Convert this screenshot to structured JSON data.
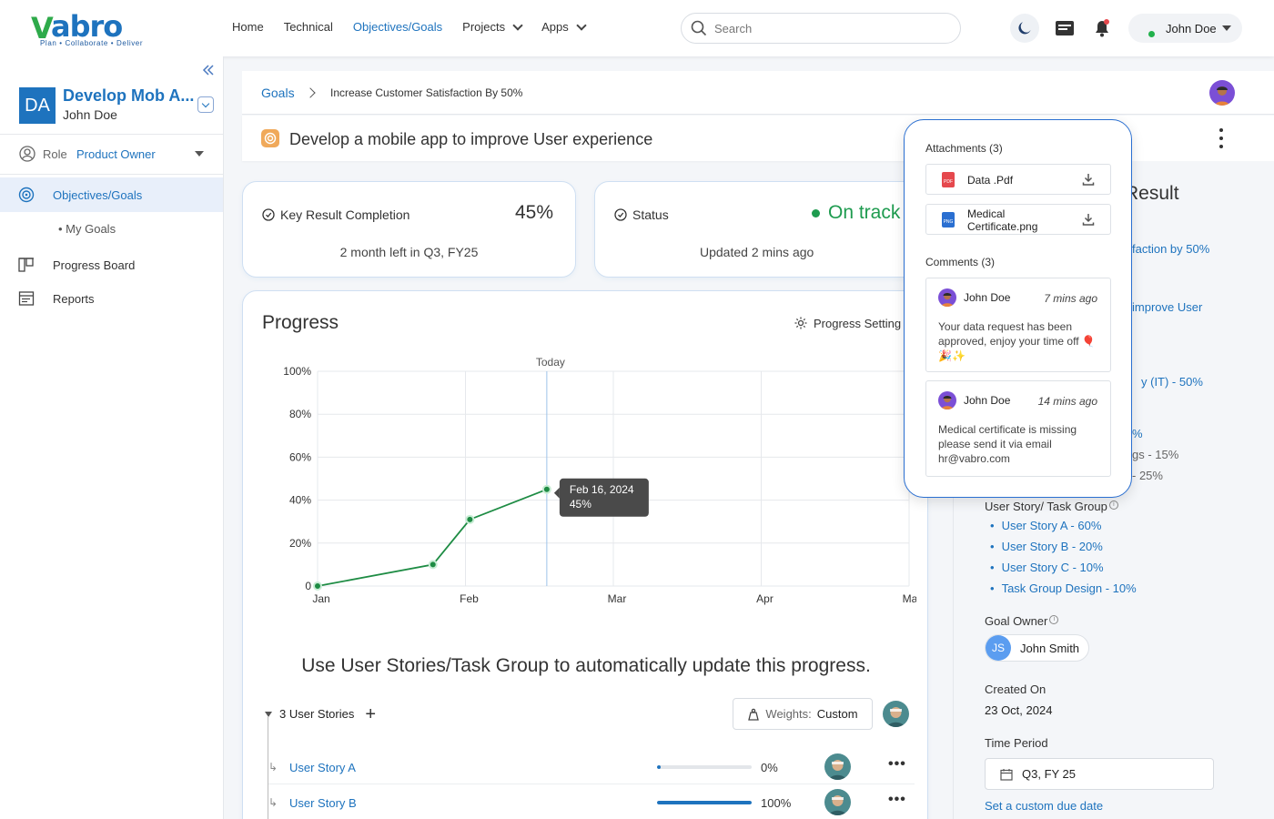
{
  "brand": {
    "name": "vabro",
    "name_v": "V",
    "name_rest": "abro",
    "tagline": "Plan • Collaborate • Deliver",
    "colors": {
      "primary": "#1e73be",
      "accent_green": "#2eaa4a"
    }
  },
  "topnav": {
    "items": [
      {
        "label": "Home",
        "active": false,
        "has_dropdown": false
      },
      {
        "label": "Technical",
        "active": false,
        "has_dropdown": false
      },
      {
        "label": "Objectives/Goals",
        "active": true,
        "has_dropdown": false
      },
      {
        "label": "Projects",
        "active": false,
        "has_dropdown": true
      },
      {
        "label": "Apps",
        "active": false,
        "has_dropdown": true
      }
    ],
    "search_placeholder": "Search",
    "icons": [
      "moon-icon",
      "inbox-icon",
      "bell-icon"
    ],
    "user": {
      "name": "John Doe",
      "status": "online"
    }
  },
  "sidebar": {
    "project": {
      "initials": "DA",
      "title": "Develop Mob A...",
      "owner": "John Doe"
    },
    "role": {
      "label": "Role",
      "value": "Product Owner"
    },
    "items": [
      {
        "label": "Objectives/Goals",
        "icon": "goal-icon",
        "active": true
      },
      {
        "label": "My Goals",
        "icon": "bullet",
        "active": false
      },
      {
        "label": "Progress Board",
        "icon": "board-icon",
        "active": false
      },
      {
        "label": "Reports",
        "icon": "report-icon",
        "active": false
      }
    ]
  },
  "breadcrumb": {
    "root": "Goals",
    "current": "Increase Customer Satisfaction By 50%"
  },
  "goal": {
    "title": "Develop a mobile app to improve User experience"
  },
  "key_result_card": {
    "label": "Key Result Completion",
    "value": "45%",
    "subtitle": "2 month left in Q3, FY25"
  },
  "status_card": {
    "label": "Status",
    "value": "On track",
    "updated": "Updated 2 mins ago",
    "color": "#1e9b4f"
  },
  "progress": {
    "title": "Progress",
    "settings_label": "Progress Setting",
    "auto_update_text": "Use User Stories/Task Group to automatically update this progress.",
    "stories_header": "3 User Stories",
    "weights_label": "Weights:",
    "weights_value": "Custom",
    "stories": [
      {
        "name": "User Story A",
        "percent_label": "0%",
        "progress": 0.0
      },
      {
        "name": "User Story B",
        "percent_label": "100%",
        "progress": 1.0
      }
    ]
  },
  "chart_data": {
    "type": "line",
    "x_categories": [
      "Jan",
      "Feb",
      "Mar",
      "Apr",
      "May"
    ],
    "y_ticks": [
      "0",
      "20%",
      "40%",
      "60%",
      "80%",
      "100%"
    ],
    "ylim": [
      0,
      100
    ],
    "today_label": "Today",
    "today_position": 1.55,
    "grid": true,
    "series": [
      {
        "points": [
          {
            "x": 0.0,
            "y": 0
          },
          {
            "x": 0.78,
            "y": 10
          },
          {
            "x": 1.03,
            "y": 31
          },
          {
            "x": 1.55,
            "y": 45
          }
        ],
        "color": "#1e8c44"
      }
    ],
    "tooltip": {
      "date": "Feb 16, 2024",
      "value": "45%"
    }
  },
  "details_panel": {
    "heading_partial": "Result",
    "links": [
      {
        "text": "faction by 50%"
      },
      {
        "text": "improve User"
      },
      {
        "text": "y (IT) - 50%"
      },
      {
        "text": "%"
      }
    ],
    "texts": [
      "gs - 15%",
      "- 25%"
    ],
    "group_label": "User Story/ Task Group",
    "group_items": [
      "User Story A - 60%",
      "User Story B - 20%",
      "User Story C - 10%",
      "Task Group Design - 10%"
    ],
    "owner_label": "Goal Owner",
    "owner": {
      "initials": "JS",
      "name": "John Smith"
    },
    "created_label": "Created On",
    "created_value": "23 Oct, 2024",
    "period_label": "Time Period",
    "period_value": "Q3, FY 25",
    "custom_due": "Set a custom due date"
  },
  "popup": {
    "attachments_header": "Attachments (3)",
    "attachments": [
      {
        "name": "Data .Pdf",
        "type": "pdf",
        "type_label": "PDF",
        "color": "#e5484d"
      },
      {
        "name_line1": "Medical",
        "name_line2": "Certificate.png",
        "type": "png",
        "type_label": "PNG",
        "color": "#2a6fd1"
      }
    ],
    "comments_header": "Comments (3)",
    "comments": [
      {
        "author": "John Doe",
        "time": "7 mins ago",
        "text": "Your data  request has been approved, enjoy your time off 🎈🎉✨"
      },
      {
        "author": "John Doe",
        "time": "14 mins ago",
        "text": "Medical certificate is missing please send it via email hr@vabro.com"
      }
    ]
  }
}
